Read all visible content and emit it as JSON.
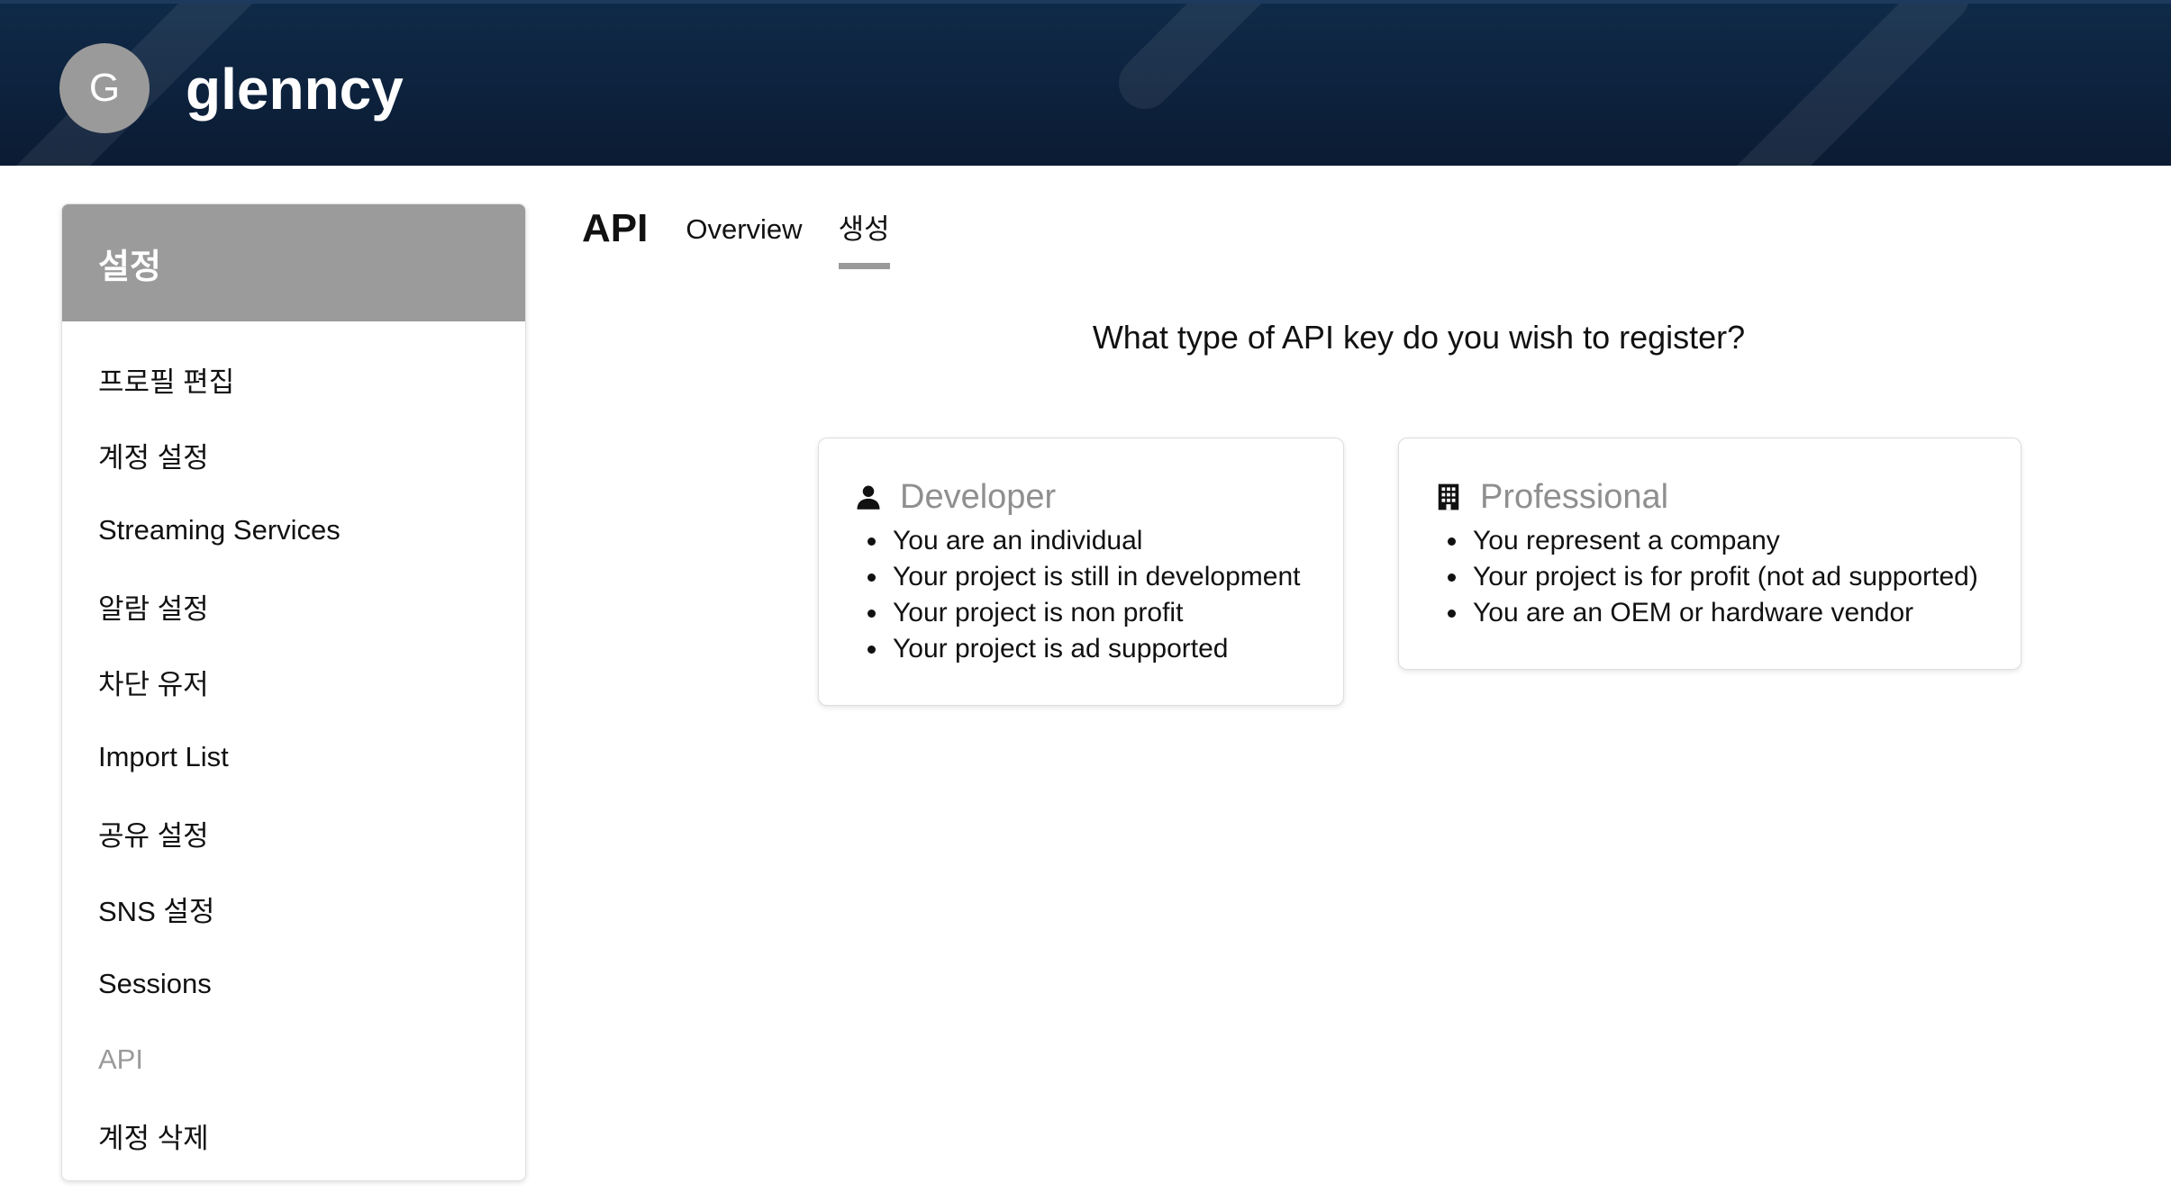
{
  "header": {
    "avatar_initial": "G",
    "username": "glenncy"
  },
  "sidebar": {
    "title": "설정",
    "items": [
      {
        "label": "프로필 편집"
      },
      {
        "label": "계정 설정"
      },
      {
        "label": "Streaming Services"
      },
      {
        "label": "알람 설정"
      },
      {
        "label": "차단 유저"
      },
      {
        "label": "Import List"
      },
      {
        "label": "공유 설정"
      },
      {
        "label": "SNS 설정"
      },
      {
        "label": "Sessions"
      },
      {
        "label": "API",
        "active": true
      },
      {
        "label": "계정 삭제"
      }
    ]
  },
  "main": {
    "title": "API",
    "tabs": [
      {
        "label": "Overview"
      },
      {
        "label": "생성",
        "active": true
      }
    ],
    "question": "What type of API key do you wish to register?",
    "cards": [
      {
        "icon": "person-icon",
        "title": "Developer",
        "bullets": [
          "You are an individual",
          "Your project is still in development",
          "Your project is non profit",
          "Your project is ad supported"
        ]
      },
      {
        "icon": "building-icon",
        "title": "Professional",
        "bullets": [
          "You represent a company",
          "Your project is for profit (not ad supported)",
          "You are an OEM or hardware vendor"
        ]
      }
    ]
  }
}
